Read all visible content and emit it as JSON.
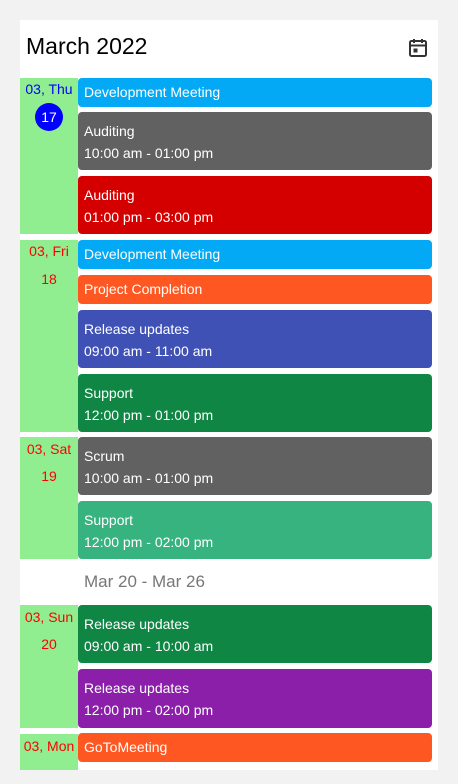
{
  "header": {
    "title": "March 2022",
    "calendar_icon": "calendar-today-icon"
  },
  "colors": {
    "day_column": "#90ee90",
    "today_circle": "#0000ff",
    "today_text": "#0000ff",
    "other_day_text": "#ff0000",
    "light_blue": "#03a9f4",
    "gray": "#616161",
    "red": "#d40000",
    "deep_orange": "#ff5722",
    "indigo": "#3f51b5",
    "green": "#0f8644",
    "light_green": "#36b37e",
    "purple": "#8b1fa9"
  },
  "days": [
    {
      "label": "03, Thu",
      "number": "17",
      "is_today": true,
      "events": [
        {
          "title": "Development Meeting",
          "time": ""
        },
        {
          "title": "Auditing",
          "time": "10:00 am - 01:00 pm"
        },
        {
          "title": "Auditing",
          "time": "01:00 pm - 03:00 pm"
        }
      ]
    },
    {
      "label": "03, Fri",
      "number": "18",
      "events": [
        {
          "title": "Development Meeting",
          "time": ""
        },
        {
          "title": "Project Completion",
          "time": ""
        },
        {
          "title": "Release updates",
          "time": "09:00 am - 11:00 am"
        },
        {
          "title": "Support",
          "time": "12:00 pm - 01:00 pm"
        }
      ]
    },
    {
      "label": "03, Sat",
      "number": "19",
      "events": [
        {
          "title": "Scrum",
          "time": "10:00 am - 01:00 pm"
        },
        {
          "title": "Support",
          "time": "12:00 pm - 02:00 pm"
        }
      ]
    },
    {
      "label": "03, Sun",
      "number": "20",
      "events": [
        {
          "title": "Release updates",
          "time": "09:00 am - 10:00 am"
        },
        {
          "title": "Release updates",
          "time": "12:00 pm - 02:00 pm"
        }
      ]
    },
    {
      "label": "03, Mon",
      "number": "",
      "events": [
        {
          "title": "GoToMeeting",
          "time": ""
        }
      ]
    }
  ],
  "week_separator": "Mar 20 - Mar 26"
}
